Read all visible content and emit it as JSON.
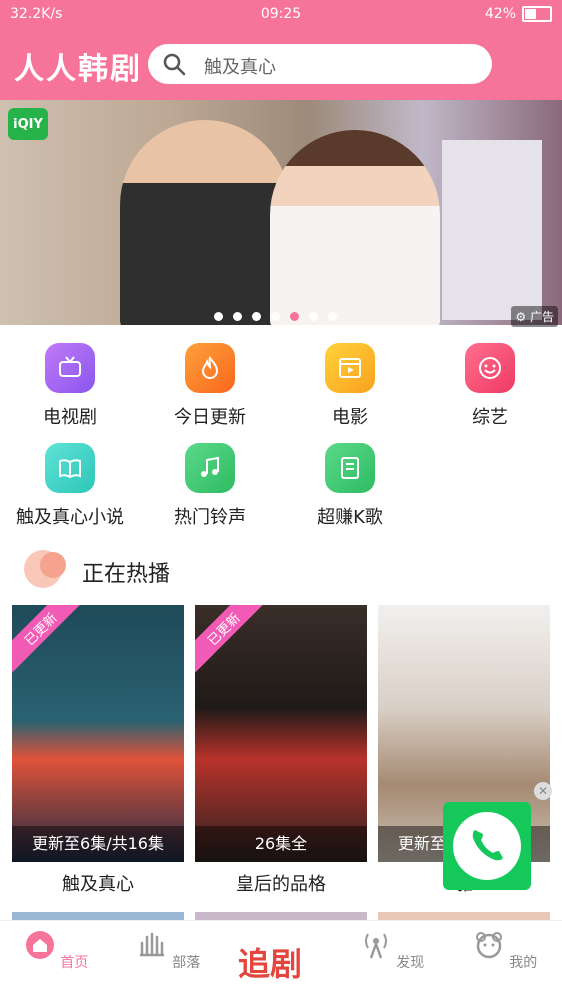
{
  "status": {
    "left": "32.2K/s",
    "time": "09:25",
    "battery": "42%"
  },
  "header": {
    "title": "人人韩剧",
    "search_placeholder": "触及真心"
  },
  "banner": {
    "logo": "iQIY",
    "ad_label": "广告",
    "dots": 7,
    "active_dot": 4
  },
  "categories": [
    {
      "label": "电视剧",
      "icon": "tv-icon",
      "color": "#a56bf0"
    },
    {
      "label": "今日更新",
      "icon": "flame-icon",
      "color": "#fb7b2c"
    },
    {
      "label": "电影",
      "icon": "film-icon",
      "color": "#fbb72c"
    },
    {
      "label": "综艺",
      "icon": "smile-icon",
      "color": "#f54d7a"
    },
    {
      "label": "触及真心小说",
      "icon": "book-icon",
      "color": "#36d0c2"
    },
    {
      "label": "热门铃声",
      "icon": "music-icon",
      "color": "#36c26a"
    },
    {
      "label": "超赚K歌",
      "icon": "document-icon",
      "color": "#34c46a"
    }
  ],
  "section": {
    "title": "正在热播"
  },
  "shows": [
    {
      "name": "触及真心",
      "episodes": "更新至6集/共16集",
      "ribbon": "已更新"
    },
    {
      "name": "皇后的品格",
      "episodes": "26集全",
      "ribbon": "已更新"
    },
    {
      "name": "雅",
      "episodes": "更新至",
      "ribbon": ""
    }
  ],
  "tabs": [
    {
      "label": "首页",
      "icon": "home-icon"
    },
    {
      "label": "部落",
      "icon": "tribe-icon"
    },
    {
      "label": "追剧",
      "icon": ""
    },
    {
      "label": "发现",
      "icon": "antenna-icon"
    },
    {
      "label": "我的",
      "icon": "bear-icon"
    }
  ],
  "colors": {
    "brand": "#f6749a",
    "accent_red": "#e4463e",
    "call_green": "#14c85a"
  }
}
